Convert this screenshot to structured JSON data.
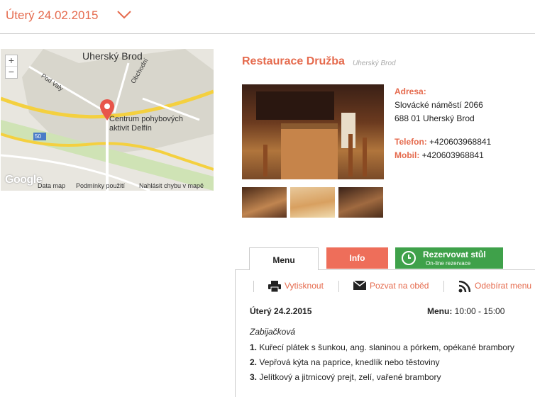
{
  "header": {
    "date": "Úterý 24.02.2015"
  },
  "map": {
    "city_label": "Uherský Brod",
    "poi_label_line1": "Centrum pohybových",
    "poi_label_line2": "aktivit Delfín",
    "street_pod_valy": "Pod Valy",
    "street_obchodni": "Obchodní",
    "road_number": "50",
    "zoom_in": "+",
    "zoom_out": "−",
    "footer_data": "Data map",
    "footer_terms": "Podmínky použití",
    "footer_report": "Nahlásit chybu v mapě",
    "logo": "Google"
  },
  "restaurant": {
    "name": "Restaurace Družba",
    "city": "Uherský Brod",
    "address_label": "Adresa:",
    "address_line1": "Slovácké náměstí 2066",
    "address_line2": "688 01 Uherský Brod",
    "phone_label": "Telefon:",
    "phone": "+420603968841",
    "mobile_label": "Mobil:",
    "mobile": "+420603968841"
  },
  "tabs": {
    "menu": "Menu",
    "info": "Info",
    "reserve": "Rezervovat stůl",
    "reserve_sub": "On-line rezervace"
  },
  "actions": {
    "print": "Vytisknout",
    "invite": "Pozvat na oběd",
    "subscribe": "Odebírat menu"
  },
  "menu": {
    "day": "Úterý 24.2.2015",
    "time_label": "Menu:",
    "time": "10:00 - 15:00",
    "special": "Zabijačková",
    "items": [
      {
        "num": "1.",
        "text": "Kuřecí plátek s šunkou, ang. slaninou a pórkem, opékané brambory"
      },
      {
        "num": "2.",
        "text": "Vepřová kýta na paprice, knedlík nebo těstoviny"
      },
      {
        "num": "3.",
        "text": "Jelítkový a jitrnicový prejt, zelí, vařené brambory"
      }
    ]
  },
  "colors": {
    "accent": "#e56a4d",
    "info_tab": "#ee6e5a",
    "reserve_tab": "#3fa14a"
  }
}
